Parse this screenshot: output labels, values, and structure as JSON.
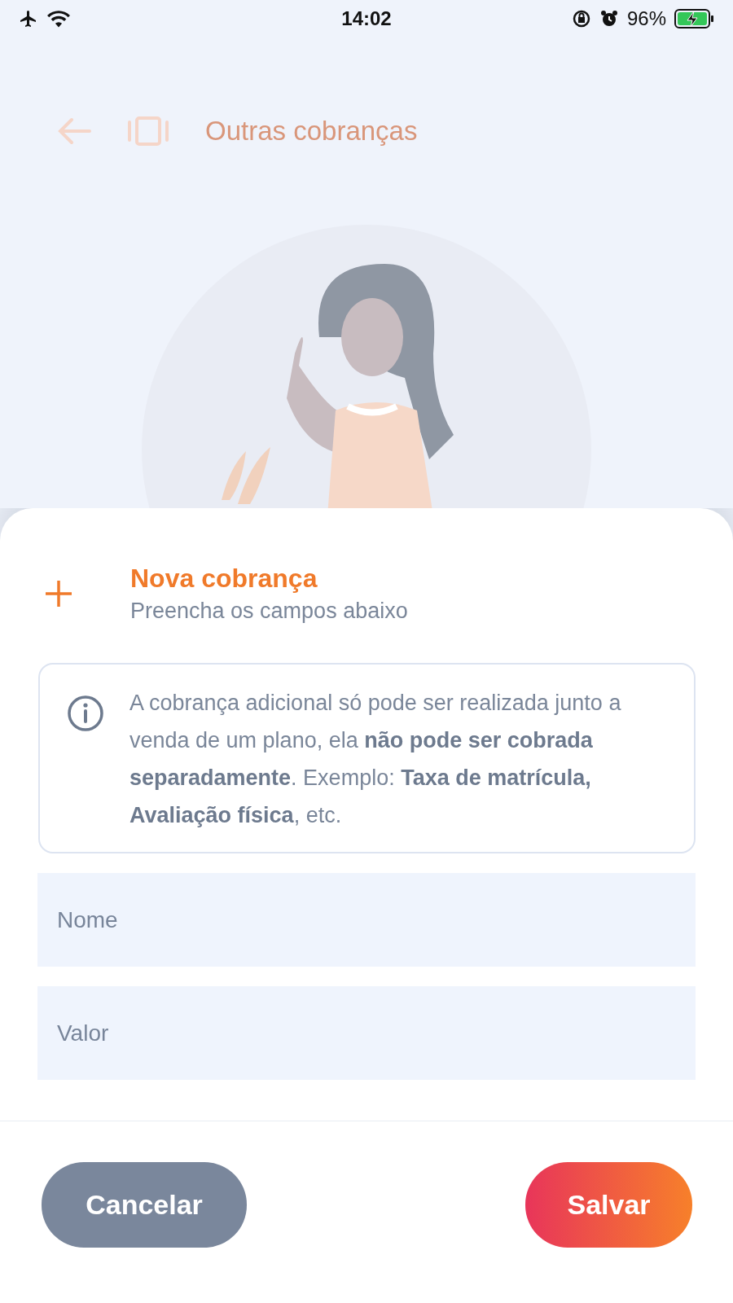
{
  "status_bar": {
    "time": "14:02",
    "battery": "96%"
  },
  "header": {
    "title": "Outras cobranças"
  },
  "sheet": {
    "title": "Nova cobrança",
    "subtitle": "Preencha os campos abaixo",
    "notice": "A cobrança adicional só pode ser realizada junto a venda de um plano, ela **não pode ser cobrada separadamente**. Exemplo: **Taxa de matrícula, Avaliação física**, etc.",
    "fields": [
      {
        "placeholder": "Nome"
      },
      {
        "placeholder": "Valor"
      }
    ],
    "buttons": [
      {
        "label": "Cancelar",
        "kind": "secondary"
      },
      {
        "label": "Salvar",
        "kind": "primary"
      }
    ]
  }
}
